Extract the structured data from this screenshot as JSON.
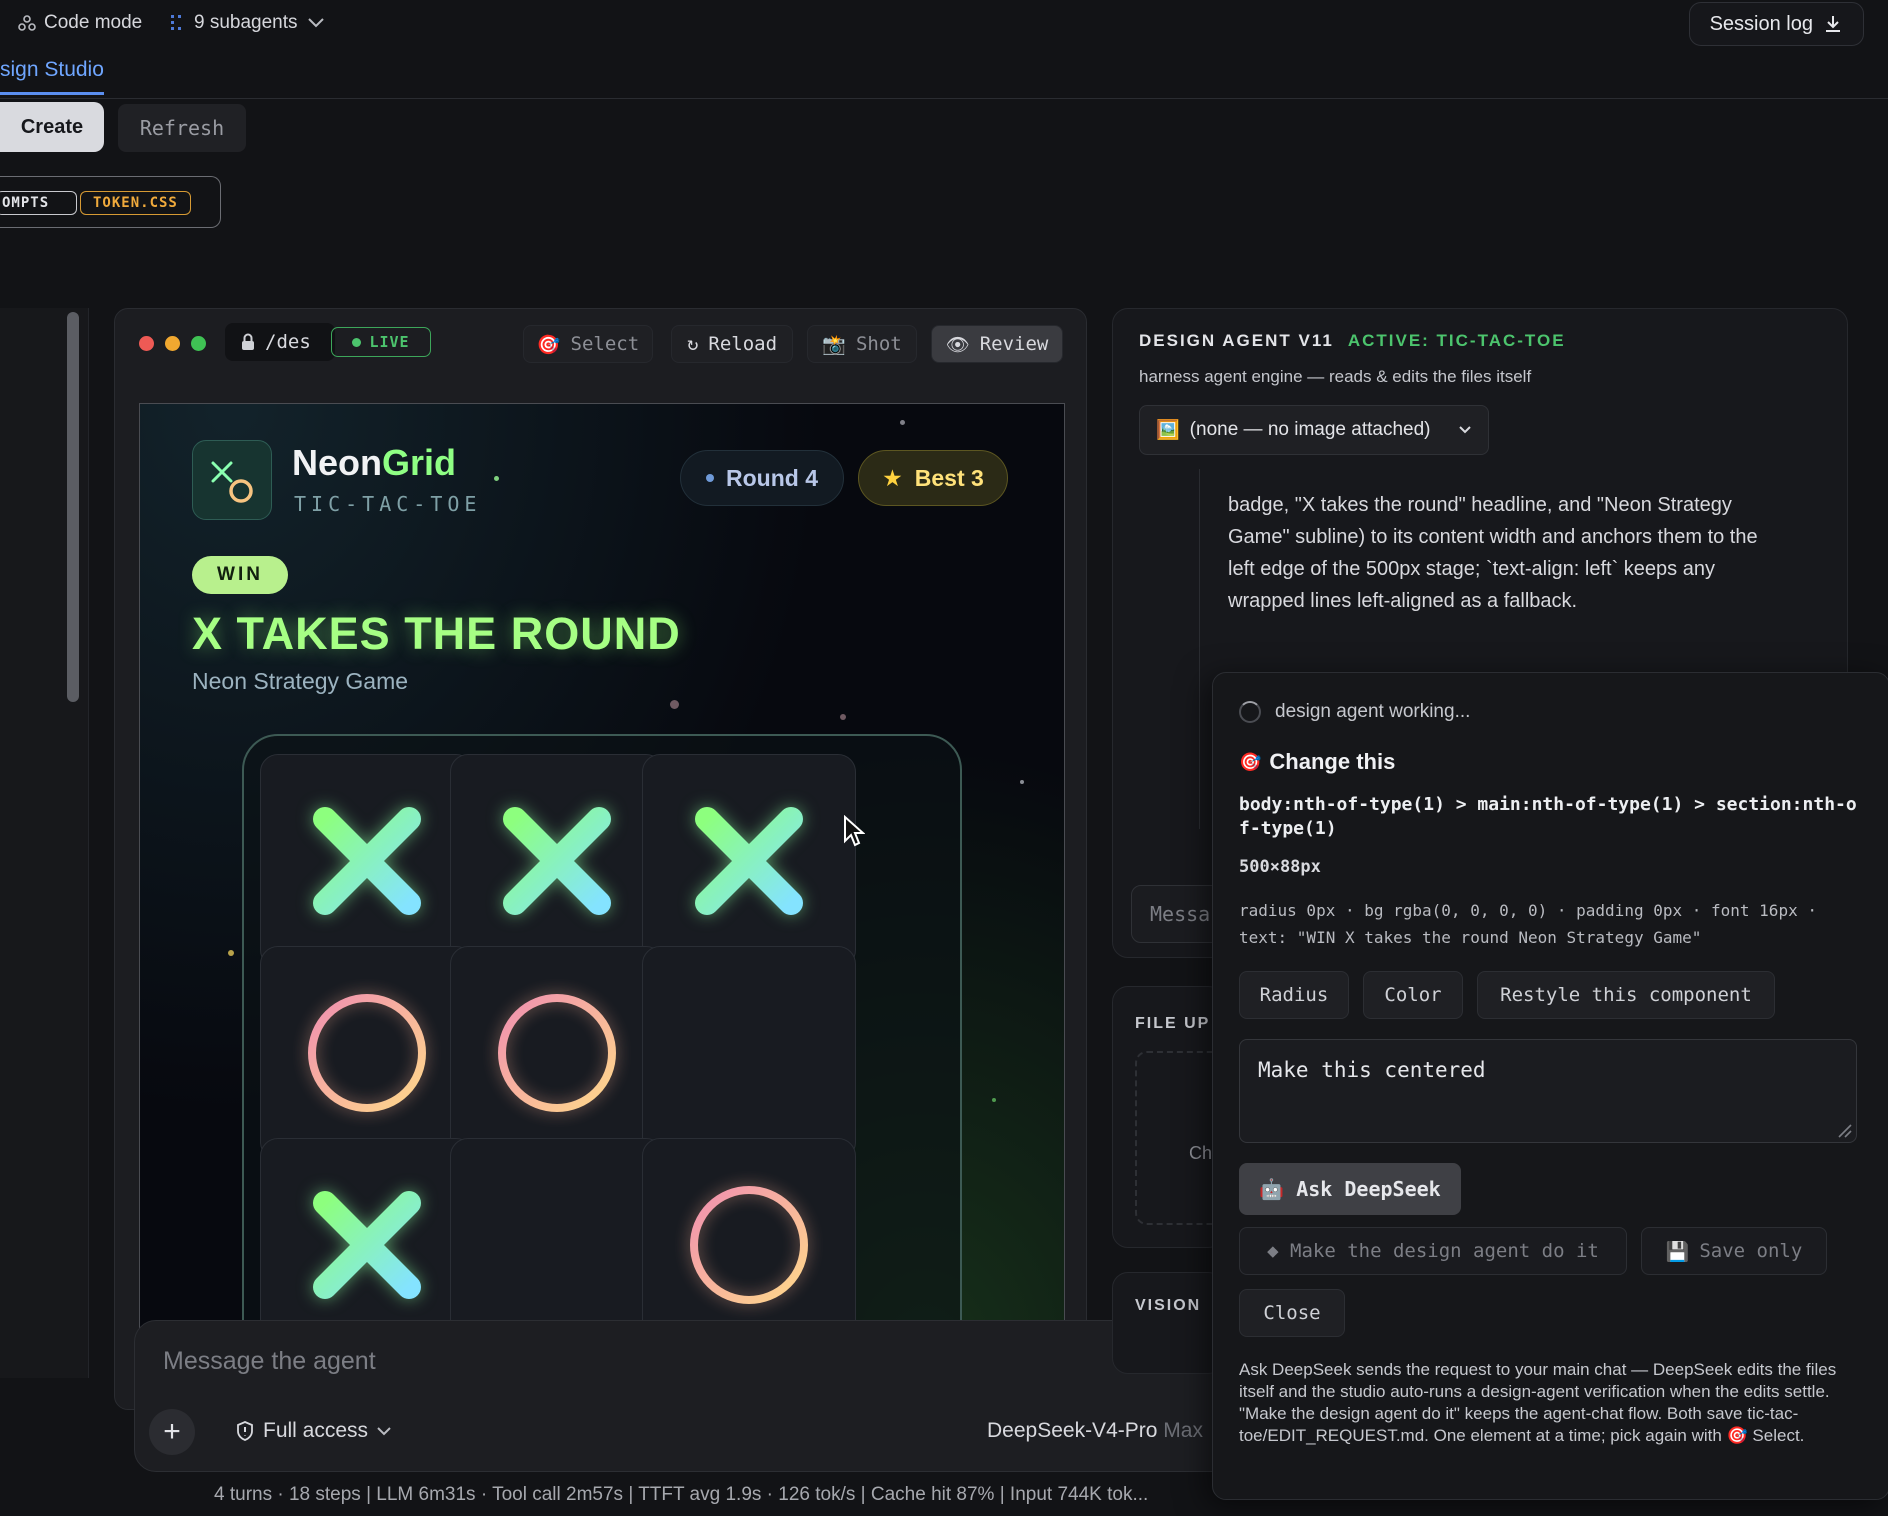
{
  "topbar": {
    "code_mode": "Code mode",
    "subagents": "9 subagents",
    "session_log": "Session log",
    "tab_active": "sign Studio"
  },
  "toolbar": {
    "create": "Create",
    "refresh": "Refresh",
    "chip_prompts": "OMPTS",
    "chip_token": "TOKEN.CSS"
  },
  "preview": {
    "address": "/des",
    "live": "LIVE",
    "buttons": {
      "select": "Select",
      "reload": "Reload",
      "shot": "Shot",
      "review": "Review"
    }
  },
  "game": {
    "brand_a": "Neon",
    "brand_b": "Grid",
    "brand_sub": "TIC-TAC-TOE",
    "round": "Round 4",
    "best": "Best 3",
    "badge": "WIN",
    "headline": "X TAKES THE ROUND",
    "subline": "Neon Strategy Game",
    "board": [
      "X",
      "X",
      "X",
      "O",
      "O",
      "",
      "X",
      "",
      "O"
    ],
    "colors": {
      "x": "#8dffa0",
      "o": "#f0a7b4",
      "accent": "#a6ff84"
    }
  },
  "composer": {
    "placeholder": "Message the agent",
    "plus": "+",
    "access": "Full access",
    "model": "DeepSeek-V4-Pro",
    "model_suffix": "Max"
  },
  "statusbar": "4 turns · 18 steps   |   LLM 6m31s · Tool call 2m57s   |   TTFT avg 1.9s · 126 tok/s   |   Cache hit 87%   |   Input 744K tok...",
  "agent": {
    "title": "DESIGN AGENT V11",
    "active": "ACTIVE: TIC-TAC-TOE",
    "desc": "harness agent engine — reads & edits the files itself",
    "image_select": "(none — no image attached)",
    "message": "badge, \"X takes the round\" headline, and \"Neon Strategy Game\" subline) to its content width and anchors them to the left edge of the 500px stage; `text-align: left` keeps any wrapped lines left-aligned as a fallback.",
    "input_placeholder": "Messa",
    "file_upload": "FILE UP",
    "file_hint": "Ch",
    "vision": "VISION"
  },
  "popup": {
    "working": "design agent working...",
    "title": "Change this",
    "selector": "body:nth-of-type(1) > main:nth-of-type(1) > section:nth-of-type(1)",
    "dims": "500×88px",
    "props": "radius 0px · bg rgba(0, 0, 0, 0) · padding 0px · font 16px · text: \"WIN X takes the round Neon Strategy Game\"",
    "btn_radius": "Radius",
    "btn_color": "Color",
    "btn_restyle": "Restyle this component",
    "request": "Make this centered",
    "ask": "Ask DeepSeek",
    "make_agent": "◆ Make the design agent do it",
    "save_only": "Save only",
    "close": "Close",
    "help": "Ask DeepSeek sends the request to your main chat — DeepSeek edits the files itself and the studio auto-runs a design-agent verification when the edits settle. \"Make the design agent do it\" keeps the agent-chat flow. Both save tic-tac-toe/EDIT_REQUEST.md. One element at a time; pick again with 🎯 Select."
  }
}
